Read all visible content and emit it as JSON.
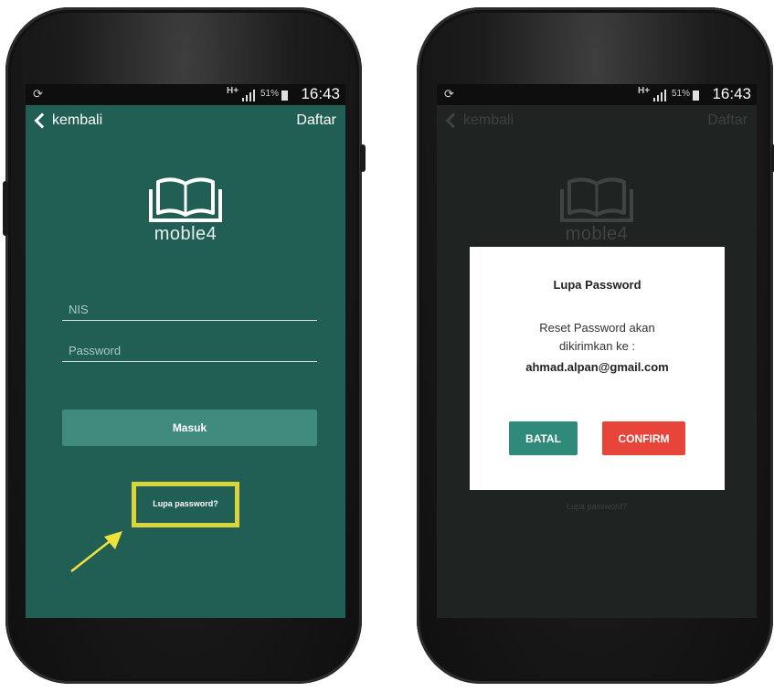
{
  "status_bar": {
    "network": "H+",
    "battery_pct": "51%",
    "time": "16:43"
  },
  "login_screen": {
    "back_label": "kembali",
    "register_label": "Daftar",
    "app_name": "moble4",
    "nis_placeholder": "NIS",
    "password_placeholder": "Password",
    "login_button": "Masuk",
    "forgot_link": "Lupa password?",
    "background_color": "#215f55",
    "highlight_color": "#d9d33c"
  },
  "dialog": {
    "title": "Lupa Password",
    "message_line1": "Reset Password akan",
    "message_line2": "dikirimkan ke :",
    "email": "ahmad.alpan@gmail.com",
    "cancel_button": "BATAL",
    "confirm_button": "CONFIRM",
    "cancel_color": "#2f8a79",
    "confirm_color": "#e8453a"
  },
  "icons": [
    "refresh-icon",
    "signal-icon",
    "battery-icon",
    "back-chevron-icon",
    "book-logo-icon",
    "pointer-arrow-icon"
  ]
}
